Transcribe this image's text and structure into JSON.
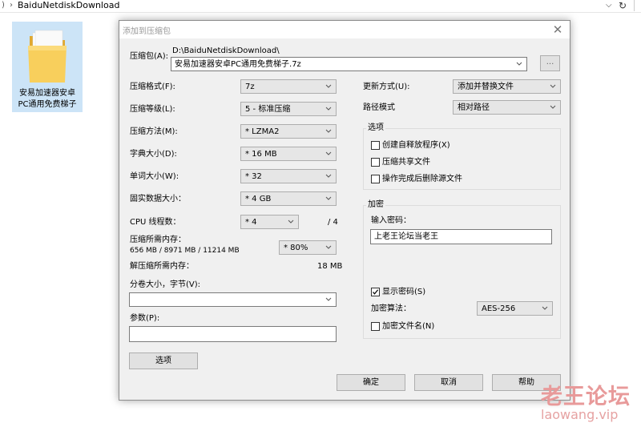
{
  "explorer": {
    "path_part": "BaiduNetdiskDownload",
    "folder_line1": "安易加速器安卓",
    "folder_line2": "PC通用免费梯子"
  },
  "dialog": {
    "title": "添加到压缩包",
    "archive_label": "压缩包(A):",
    "archive_dir": "D:\\BaiduNetdiskDownload\\",
    "archive_name": "安易加速器安卓PC通用免费梯子.7z",
    "browse_label": "...",
    "format": {
      "label": "压缩格式(F):",
      "value": "7z"
    },
    "level": {
      "label": "压缩等级(L):",
      "value": "5 - 标准压缩"
    },
    "method": {
      "label": "压缩方法(M):",
      "value": "* LZMA2"
    },
    "dict": {
      "label": "字典大小(D):",
      "value": "* 16 MB"
    },
    "word": {
      "label": "单词大小(W):",
      "value": "* 32"
    },
    "solid": {
      "label": "固实数据大小：",
      "value": "* 4 GB"
    },
    "threads": {
      "label": "CPU 线程数：",
      "value": "* 4",
      "max": "/ 4"
    },
    "mem_compress": {
      "label": "压缩所需内存：",
      "detail": "656 MB / 8971 MB / 11214 MB",
      "value": "* 80%"
    },
    "mem_decompress": {
      "label": "解压缩所需内存：",
      "value": "18 MB"
    },
    "volume": {
      "label": "分卷大小，字节(V):",
      "value": ""
    },
    "params": {
      "label": "参数(P):",
      "value": ""
    },
    "options_button": "选项",
    "update": {
      "label": "更新方式(U):",
      "value": "添加并替换文件"
    },
    "path_mode": {
      "label": "路径模式",
      "value": "相对路径"
    },
    "options_group": {
      "title": "选项",
      "sfx": "创建自释放程序(X)",
      "shared": "压缩共享文件",
      "delete": "操作完成后删除源文件"
    },
    "encryption": {
      "title": "加密",
      "pwd_label": "输入密码：",
      "pwd_value": "上老王论坛当老王",
      "show_pwd": "显示密码(S)",
      "method_label": "加密算法：",
      "method_value": "AES-256",
      "encrypt_names": "加密文件名(N)"
    },
    "ok": "确定",
    "cancel": "取消",
    "help": "帮助"
  },
  "watermark": {
    "line1": "老王论坛",
    "line2": "laowang.vip"
  }
}
